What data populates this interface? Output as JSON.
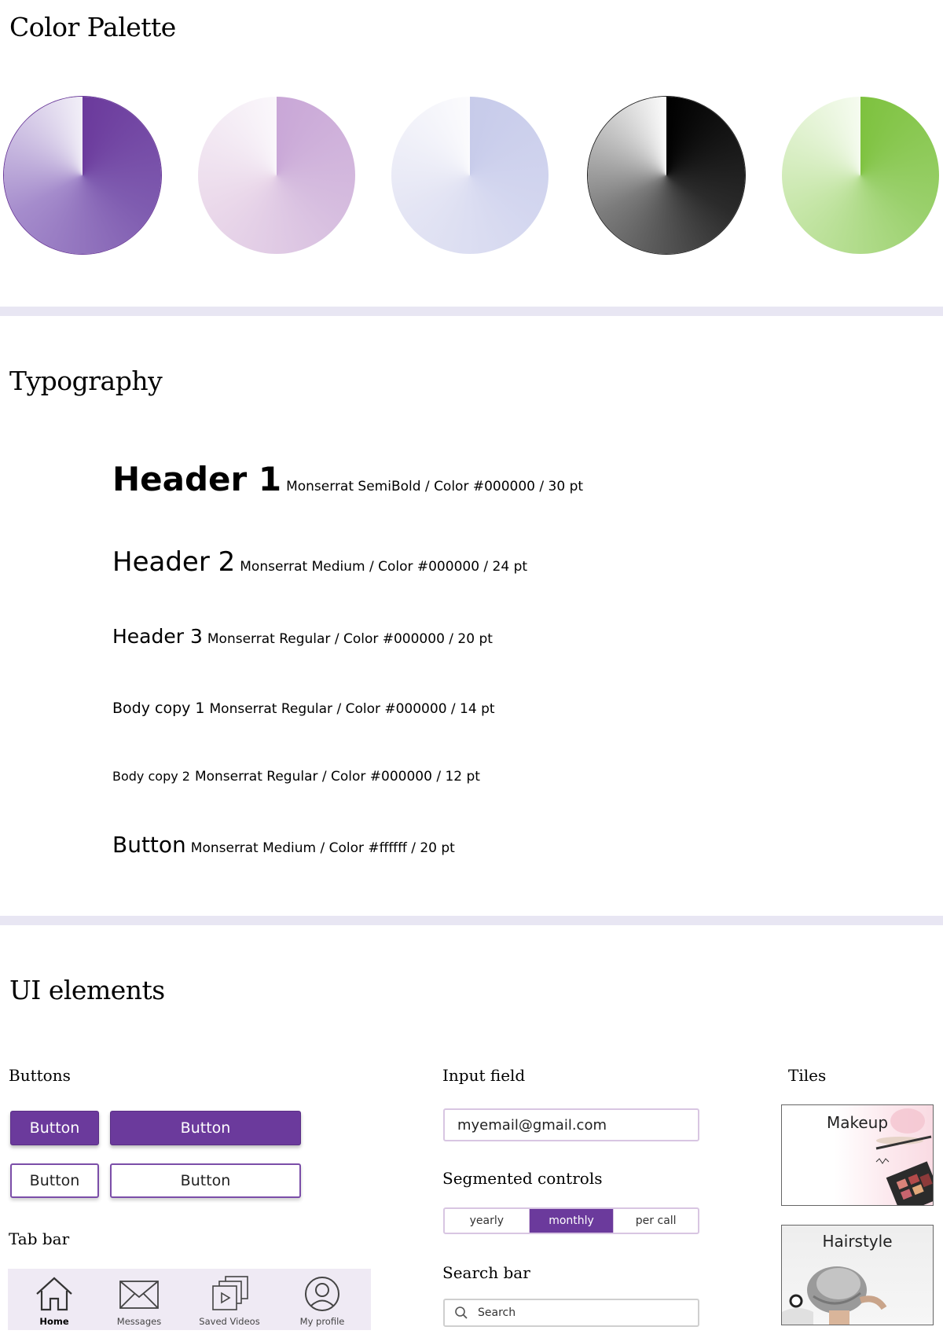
{
  "palette": {
    "title": "Color Palette",
    "swatches": [
      {
        "name": "purple",
        "color": "#6b3a9c"
      },
      {
        "name": "lilac",
        "color": "#c9a7d7"
      },
      {
        "name": "periwinkle",
        "color": "#c7cbea"
      },
      {
        "name": "black",
        "color": "#000000"
      },
      {
        "name": "green",
        "color": "#7ec23f"
      }
    ]
  },
  "typography": {
    "title": "Typography",
    "rows": [
      {
        "label": "Header 1",
        "spec": "Monserrat SemiBold / Color #000000 / 30 pt"
      },
      {
        "label": "Header 2",
        "spec": "Monserrat Medium / Color #000000 / 24 pt"
      },
      {
        "label": "Header 3",
        "spec": "Monserrat Regular / Color #000000 / 20 pt"
      },
      {
        "label": "Body copy 1",
        "spec": "Monserrat Regular / Color #000000 / 14 pt"
      },
      {
        "label": "Body copy 2",
        "spec": "Monserrat Regular / Color #000000 / 12 pt"
      },
      {
        "label": "Button",
        "spec": "Monserrat Medium / Color #ffffff / 20 pt"
      }
    ]
  },
  "ui": {
    "title": "UI elements",
    "buttons": {
      "title": "Buttons",
      "labels": [
        "Button",
        "Button",
        "Button",
        "Button"
      ]
    },
    "tabbar": {
      "title": "Tab bar",
      "tabs": [
        {
          "label": "Home",
          "icon": "home-icon"
        },
        {
          "label": "Messages",
          "icon": "envelope-icon"
        },
        {
          "label": "Saved Videos",
          "icon": "video-stack-icon"
        },
        {
          "label": "My profile",
          "icon": "profile-icon"
        }
      ]
    },
    "input": {
      "title": "Input field",
      "value": "myemail@gmail.com"
    },
    "segmented": {
      "title": "Segmented controls",
      "options": [
        "yearly",
        "monthly",
        "per call"
      ],
      "selected": "monthly"
    },
    "search": {
      "title": "Search bar",
      "placeholder": "Search"
    },
    "tiles": {
      "title": "Tiles",
      "items": [
        "Makeup",
        "Hairstyle"
      ]
    }
  },
  "colors": {
    "accent": "#6b3a9c",
    "divider": "#e8e6f3"
  }
}
